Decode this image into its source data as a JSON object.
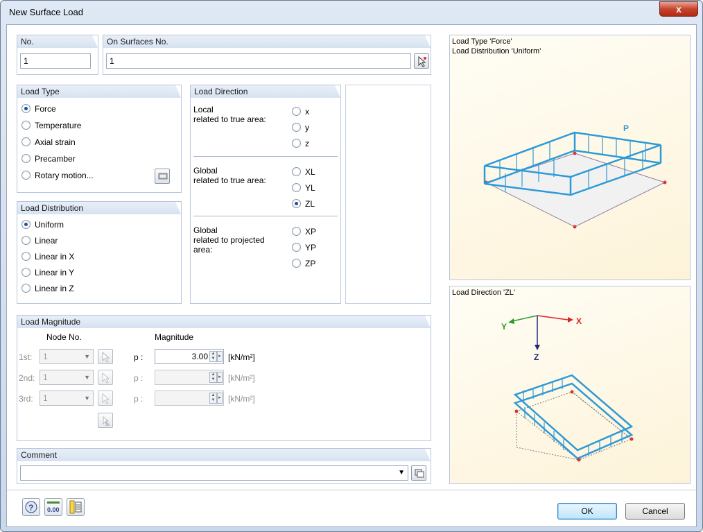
{
  "window": {
    "title": "New Surface Load",
    "close_label": "x"
  },
  "no": {
    "label": "No.",
    "value": "1"
  },
  "on_surfaces": {
    "label": "On Surfaces No.",
    "value": "1"
  },
  "load_type": {
    "header": "Load Type",
    "options": [
      "Force",
      "Temperature",
      "Axial strain",
      "Precamber",
      "Rotary motion..."
    ],
    "selected": "Force"
  },
  "load_direction": {
    "header": "Load Direction",
    "groups": [
      {
        "caption_line1": "Local",
        "caption_line2": "related to true area:",
        "caption_line3": "",
        "options": [
          "x",
          "y",
          "z"
        ]
      },
      {
        "caption_line1": "Global",
        "caption_line2": "related to true area:",
        "caption_line3": "",
        "options": [
          "XL",
          "YL",
          "ZL"
        ]
      },
      {
        "caption_line1": "Global",
        "caption_line2": "related to projected",
        "caption_line3": "area:",
        "options": [
          "XP",
          "YP",
          "ZP"
        ]
      }
    ],
    "selected": "ZL"
  },
  "load_distribution": {
    "header": "Load Distribution",
    "options": [
      "Uniform",
      "Linear",
      "Linear in X",
      "Linear in Y",
      "Linear in Z"
    ],
    "selected": "Uniform"
  },
  "load_magnitude": {
    "header": "Load Magnitude",
    "node_no_label": "Node No.",
    "magnitude_label": "Magnitude",
    "rows": [
      {
        "label": "1st:",
        "node": "1",
        "p_label": "p :",
        "value": "3.00",
        "unit": "[kN/m²]",
        "enabled": true
      },
      {
        "label": "2nd:",
        "node": "1",
        "p_label": "p :",
        "value": "",
        "unit": "[kN/m²]",
        "enabled": false
      },
      {
        "label": "3rd:",
        "node": "1",
        "p_label": "p :",
        "value": "",
        "unit": "[kN/m²]",
        "enabled": false
      }
    ]
  },
  "comment": {
    "header": "Comment",
    "value": ""
  },
  "preview_top": {
    "line1": "Load Type 'Force'",
    "line2": "Load Distribution 'Uniform'",
    "load_symbol": "P"
  },
  "preview_bottom": {
    "caption": "Load Direction 'ZL'",
    "axis_x": "X",
    "axis_y": "Y",
    "axis_z": "Z"
  },
  "buttons": {
    "ok": "OK",
    "cancel": "Cancel"
  },
  "colors": {
    "load_blue": "#2d9ad8",
    "axis_red": "#e02020",
    "axis_green": "#2a9a2a",
    "axis_navy": "#1f2a7a"
  }
}
